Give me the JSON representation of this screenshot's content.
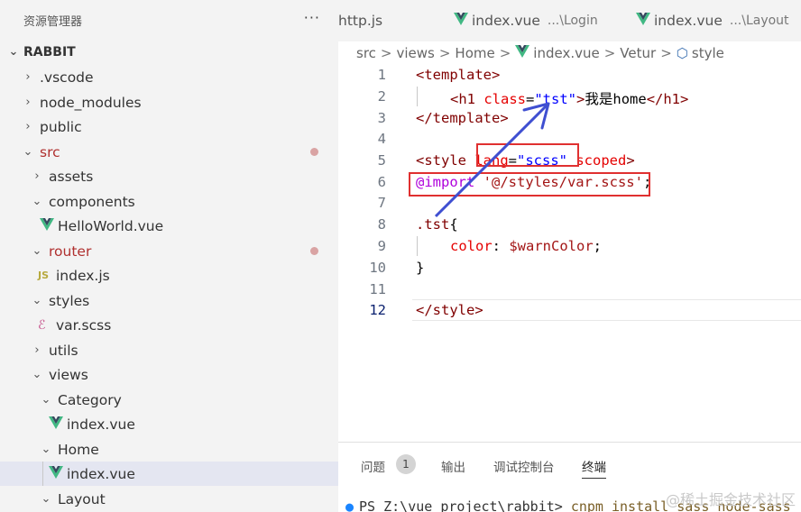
{
  "explorer": {
    "title": "资源管理器",
    "more": "···",
    "project": "RABBIT",
    "items": [
      {
        "label": ".vscode"
      },
      {
        "label": "node_modules"
      },
      {
        "label": "public"
      },
      {
        "label": "src"
      },
      {
        "label": "assets"
      },
      {
        "label": "components"
      },
      {
        "label": "HelloWorld.vue"
      },
      {
        "label": "router"
      },
      {
        "label": "index.js"
      },
      {
        "label": "styles"
      },
      {
        "label": "var.scss"
      },
      {
        "label": "utils"
      },
      {
        "label": "views"
      },
      {
        "label": "Category"
      },
      {
        "label": "index.vue"
      },
      {
        "label": "Home"
      },
      {
        "label": "index.vue"
      },
      {
        "label": "Layout"
      }
    ],
    "js_badge": "JS"
  },
  "tabs": [
    {
      "name": "http.js",
      "desc": ""
    },
    {
      "name": "index.vue",
      "desc": "...\\Login"
    },
    {
      "name": "index.vue",
      "desc": "...\\Layout"
    }
  ],
  "breadcrumb": [
    "src",
    "views",
    "Home",
    "index.vue",
    "Vetur",
    "style"
  ],
  "breadcrumb_sep": ">",
  "code": {
    "line_numbers": [
      "1",
      "2",
      "3",
      "4",
      "5",
      "6",
      "7",
      "8",
      "9",
      "10",
      "11",
      "12"
    ],
    "l1_open": "<template>",
    "l2_open": "<h1 ",
    "l2_attr": "class",
    "l2_eq": "=",
    "l2_val": "\"tst\"",
    "l2_gt": ">",
    "l2_text": "我是home",
    "l2_close": "</h1>",
    "l3_close": "</template>",
    "l5_open": "<style ",
    "l5_attr": "lang",
    "l5_eq": "=",
    "l5_val": "\"scss\"",
    "l5_scoped": " scoped",
    "l5_gt": ">",
    "l6_kw": "@import",
    "l6_val": " '@/styles/var.scss'",
    "l6_semi": ";",
    "l8_sel": ".tst",
    "l8_brace": "{",
    "l9_prop": "color",
    "l9_colon": ": ",
    "l9_var": "$warnColor",
    "l9_semi": ";",
    "l10_close": "}",
    "l12_close": "</style>"
  },
  "panel": {
    "tabs": [
      "问题",
      "输出",
      "调试控制台",
      "终端"
    ],
    "problem_count": "1",
    "terminal_prompt": "PS Z:\\vue_project\\rabbit>",
    "terminal_cmd": " cnpm install sass node-sass"
  },
  "watermark": "@稀土掘金技术社区",
  "colors": {
    "sidebar_bg": "#f3f3f3",
    "active_row": "#e4e6f1",
    "vue_green": "#41b883",
    "annotation_red": "#e03030",
    "annotation_arrow": "#3f4fd1"
  }
}
